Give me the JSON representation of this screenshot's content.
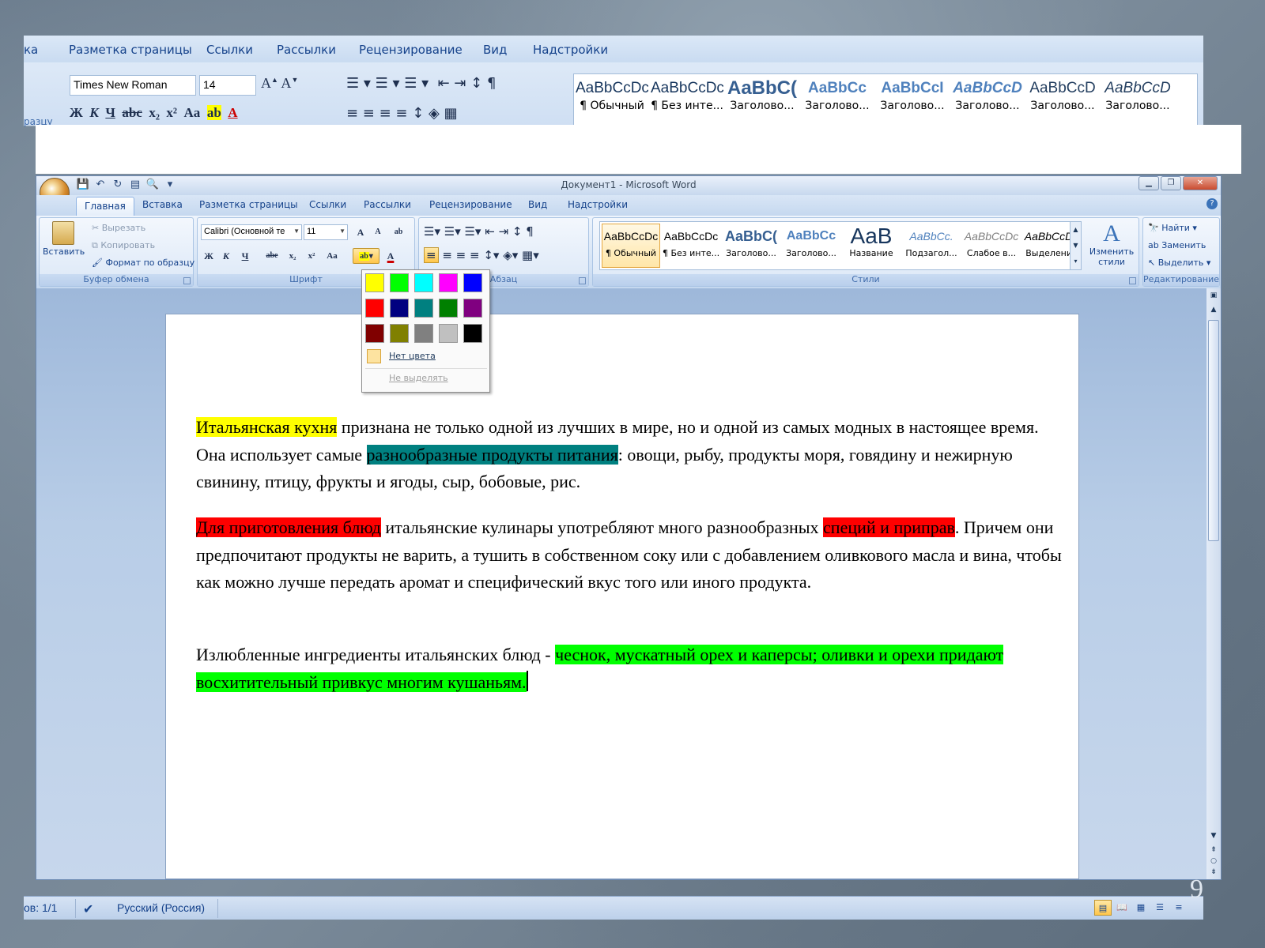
{
  "background_ribbon": {
    "tabs": [
      "ка",
      "Разметка страницы",
      "Ссылки",
      "Рассылки",
      "Рецензирование",
      "Вид",
      "Надстройки"
    ],
    "font_name": "Times New Roman",
    "font_size": "14",
    "left_fragment": "разцу",
    "styles": [
      {
        "sample": "AaBbCcDc",
        "name": "¶ Обычный"
      },
      {
        "sample": "AaBbCcDc",
        "name": "¶ Без инте..."
      },
      {
        "sample": "AaBbC(",
        "name": "Заголово..."
      },
      {
        "sample": "AaBbCc",
        "name": "Заголово..."
      },
      {
        "sample": "AaBbCcI",
        "name": "Заголово..."
      },
      {
        "sample": "AaBbCcD",
        "name": "Заголово..."
      },
      {
        "sample": "AaBbCcD",
        "name": "Заголово..."
      },
      {
        "sample": "AaBbCcD",
        "name": "Заголово..."
      }
    ]
  },
  "window": {
    "title": "Документ1 - Microsoft Word",
    "tabs": [
      "Главная",
      "Вставка",
      "Разметка страницы",
      "Ссылки",
      "Рассылки",
      "Рецензирование",
      "Вид",
      "Надстройки"
    ],
    "active_tab": "Главная"
  },
  "clipboard": {
    "paste": "Вставить",
    "cut": "Вырезать",
    "copy": "Копировать",
    "format_painter": "Формат по образцу",
    "label": "Буфер обмена"
  },
  "font": {
    "name": "Calibri (Основной те",
    "size": "11",
    "label": "Шрифт",
    "bold": "Ж",
    "italic": "К",
    "underline": "Ч",
    "strike": "abe",
    "subscript": "x₂",
    "superscript": "x²",
    "case": "Aa"
  },
  "paragraph": {
    "label": "Абзац"
  },
  "styles": {
    "label": "Стили",
    "items": [
      {
        "sample": "AaBbCcDc",
        "name": "¶ Обычный"
      },
      {
        "sample": "AaBbCcDc",
        "name": "¶ Без инте..."
      },
      {
        "sample": "AaBbC(",
        "name": "Заголово..."
      },
      {
        "sample": "AaBbCc",
        "name": "Заголово..."
      },
      {
        "sample": "AaB",
        "name": "Название"
      },
      {
        "sample": "AaBbCc.",
        "name": "Подзагол..."
      },
      {
        "sample": "AaBbCcDc",
        "name": "Слабое в..."
      },
      {
        "sample": "AaBbCcDc",
        "name": "Выделение"
      }
    ],
    "change": "Изменить стили"
  },
  "editing": {
    "label": "Редактирование",
    "find": "Найти",
    "replace": "Заменить",
    "select": "Выделить"
  },
  "highlight_menu": {
    "colors": [
      "#ffff00",
      "#00ff00",
      "#00ffff",
      "#ff00ff",
      "#0000ff",
      "#ff0000",
      "#000080",
      "#008080",
      "#008000",
      "#800080",
      "#800000",
      "#808000",
      "#808080",
      "#c0c0c0",
      "#000000"
    ],
    "no_color": "Нет цвета",
    "stop": "Не выделять"
  },
  "document": {
    "p1": {
      "a": "Итальянская кухня",
      "b": " признана не только одной из лучших в мире, но и одной из самых модных в настоящее время. Она использует самые ",
      "c": "разнообразные продукты питания",
      "d": ": овощи, рыбу, продукты моря, говядину и нежирную свинину, птицу, фрукты и ягоды, сыр, бобовые, рис."
    },
    "p2": {
      "a": "Для приготовления блюд",
      "b": " итальянские кулинары употребляют много разнообразных ",
      "c": "специй и приправ",
      "d": ". Причем они предпочитают продукты не варить, а тушить в собственном соку или с добавлением оливкового масла и вина, чтобы как можно лучше передать аромат и специфический вкус того или иного продукта."
    },
    "p3": {
      "a": "Излюбленные ингредиенты итальянских блюд - ",
      "b": "чеснок, мускатный орех и каперсы; оливки и орехи придают восхитительный привкус многим кушаньям."
    }
  },
  "status": {
    "pages": "ов: 1/1",
    "language": "Русский (Россия)"
  },
  "slide_number": "9"
}
